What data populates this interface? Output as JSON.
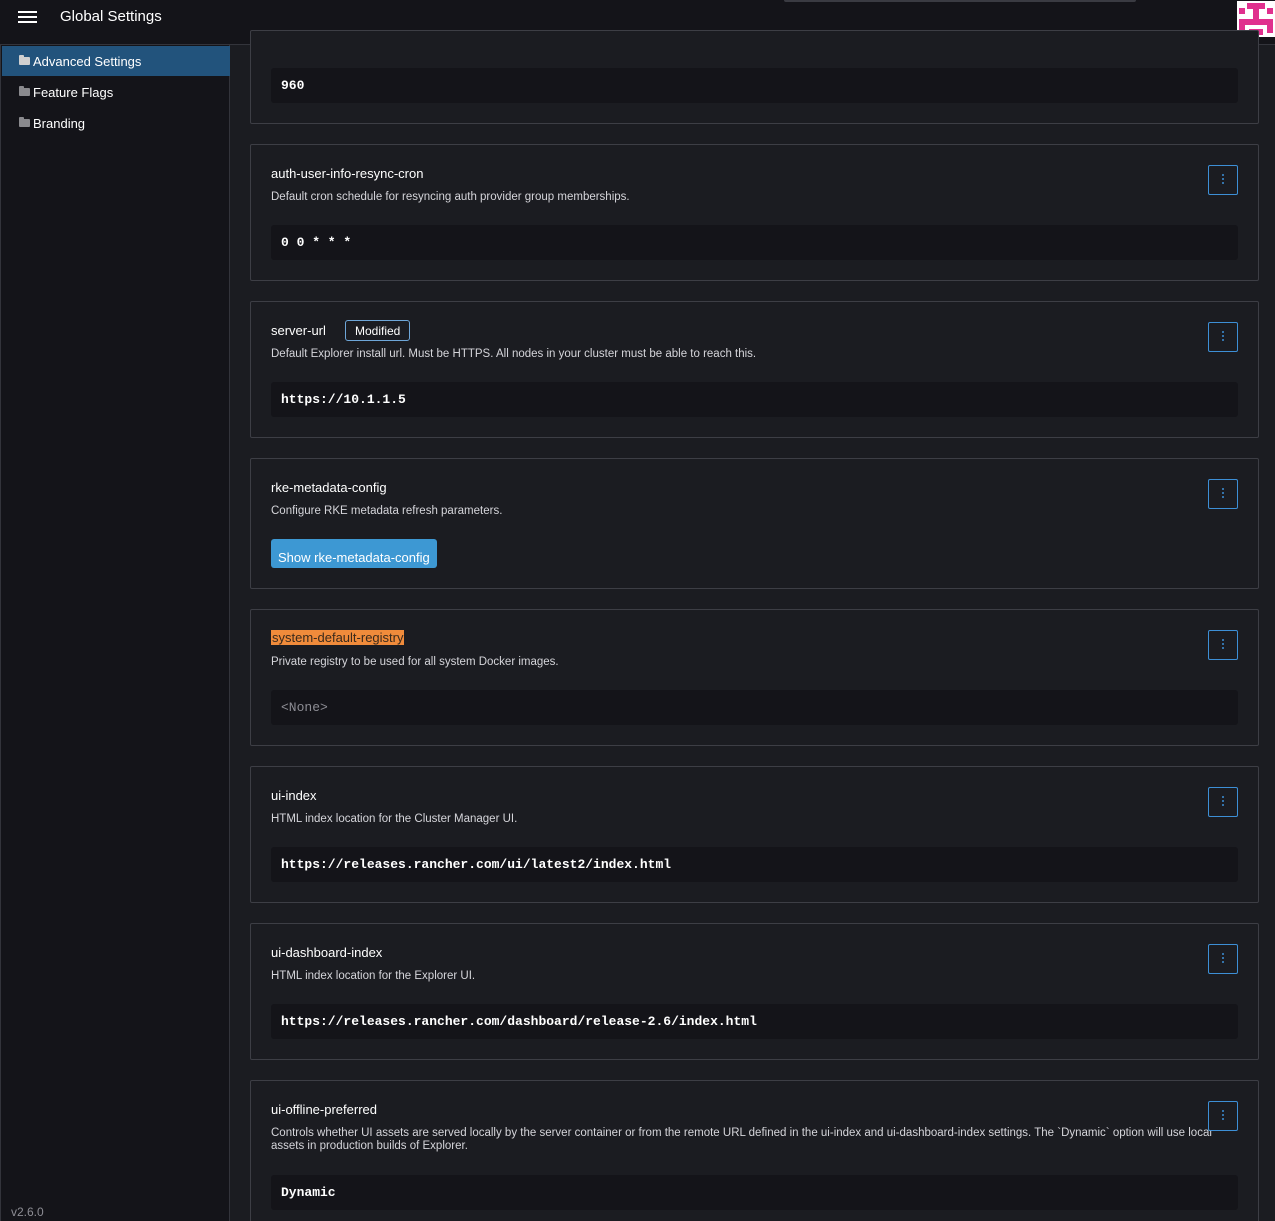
{
  "header": {
    "title": "Global Settings",
    "menu_icon": "hamburger-icon"
  },
  "sidebar": {
    "items": [
      {
        "label": "Advanced Settings",
        "icon": "folder-open-icon",
        "active": true
      },
      {
        "label": "Feature Flags",
        "icon": "folder-icon",
        "active": false
      },
      {
        "label": "Branding",
        "icon": "folder-icon",
        "active": false
      }
    ],
    "version": "v2.6.0"
  },
  "settings": [
    {
      "value": "960"
    },
    {
      "name": "auth-user-info-resync-cron",
      "description": "Default cron schedule for resyncing auth provider group memberships.",
      "value": "0 0 * * *"
    },
    {
      "name": "server-url",
      "badge": "Modified",
      "description": "Default Explorer install url. Must be HTTPS. All nodes in your cluster must be able to reach this.",
      "value": "https://10.1.1.5"
    },
    {
      "name": "rke-metadata-config",
      "description": "Configure RKE metadata refresh parameters.",
      "button_label": "Show rke-metadata-config"
    },
    {
      "name": "system-default-registry",
      "description": "Private registry to be used for all system Docker images.",
      "value": "<None>"
    },
    {
      "name": "ui-index",
      "description": "HTML index location for the Cluster Manager UI.",
      "value": "https://releases.rancher.com/ui/latest2/index.html"
    },
    {
      "name": "ui-dashboard-index",
      "description": "HTML index location for the Explorer UI.",
      "value": "https://releases.rancher.com/dashboard/release-2.6/index.html"
    },
    {
      "name": "ui-offline-preferred",
      "description": "Controls whether UI assets are served locally by the server container or from the remote URL defined in the ui-index and ui-dashboard-index settings. The `Dynamic` option will use local assets in production builds of Explorer.",
      "value": "Dynamic"
    }
  ],
  "colors": {
    "accent": "#3d98d3",
    "highlight": "#f08b3b",
    "active_nav": "#22537c"
  }
}
